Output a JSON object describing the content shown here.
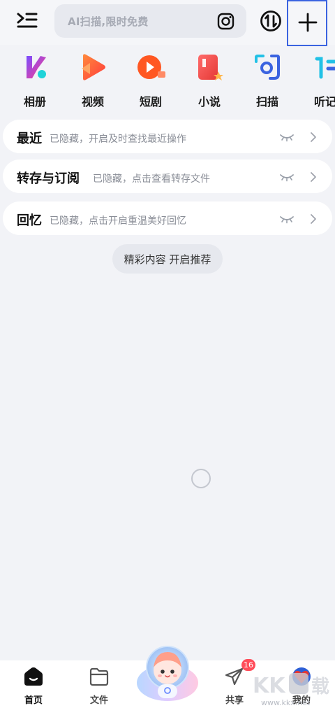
{
  "header": {
    "search_placeholder": "AI扫描,限时免费"
  },
  "apps": [
    {
      "label": "相册",
      "icon": "album-icon"
    },
    {
      "label": "视频",
      "icon": "video-icon"
    },
    {
      "label": "短剧",
      "icon": "short-drama-icon"
    },
    {
      "label": "小说",
      "icon": "novel-icon"
    },
    {
      "label": "扫描",
      "icon": "scan-icon"
    },
    {
      "label": "听记",
      "icon": "listen-note-icon"
    }
  ],
  "sections": [
    {
      "title": "最近",
      "desc": "已隐藏，开启及时查找最近操作"
    },
    {
      "title": "转存与订阅",
      "desc": "已隐藏，点击查看转存文件"
    },
    {
      "title": "回忆",
      "desc": "已隐藏，点击开启重温美好回忆"
    }
  ],
  "recommend_button": "精彩内容 开启推荐",
  "bottom_nav": {
    "home": "首页",
    "files": "文件",
    "share": "共享",
    "share_badge": "16",
    "mine": "我的"
  },
  "watermark": {
    "logo_text": "KK下载",
    "url": "www.kkx.net"
  },
  "colors": {
    "accent_blue": "#3a63e0",
    "badge_red": "#ff4d5a",
    "background": "#f2f3f7"
  }
}
